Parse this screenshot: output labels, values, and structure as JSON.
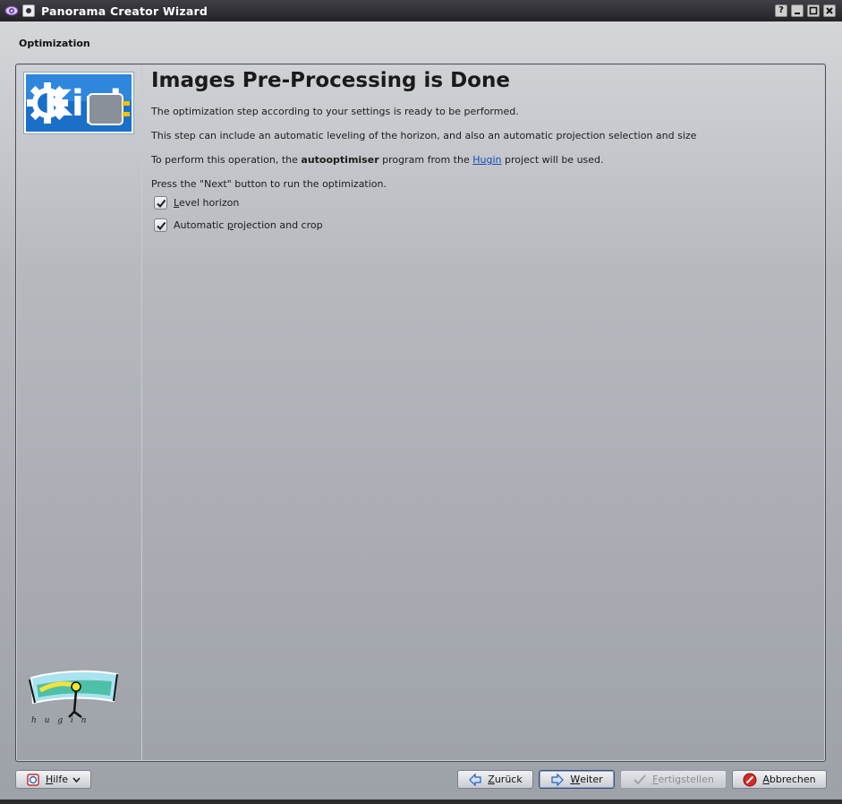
{
  "window": {
    "title": "Panorama Creator Wizard",
    "help_btn": "?",
    "minimize_btn": "–",
    "maximize_btn": "□",
    "close_btn": "✕"
  },
  "step_header": "Optimization",
  "page": {
    "title": "Images Pre-Processing is Done",
    "para1": "The optimization step according to your settings is ready to be performed.",
    "para2": "This step can include an automatic leveling of the horizon, and also an automatic projection selection and size",
    "para3_before": "To perform this operation, the ",
    "para3_program": "autooptimiser",
    "para3_middle": " program from the ",
    "para3_link": "Hugin",
    "para3_after": " project will be used.",
    "para4": "Press the \"Next\" button to run the optimization."
  },
  "options": [
    {
      "label_prefix": "",
      "mnemonic": "L",
      "label_suffix": "evel horizon",
      "checked": true
    },
    {
      "label_prefix": "Automatic ",
      "mnemonic": "p",
      "label_suffix": "rojection and crop",
      "checked": true
    }
  ],
  "logos": {
    "left_top": "kipi-logo",
    "left_bottom": "hugin-logo",
    "kipi_text": "Kipi",
    "hugin_text": "h u g i n"
  },
  "buttons": {
    "help": {
      "mnemonic": "H",
      "rest": "ilfe",
      "icon": "help-book-icon"
    },
    "back": {
      "mnemonic": "Z",
      "rest": "urück",
      "icon": "arrow-left-icon"
    },
    "next": {
      "mnemonic": "W",
      "rest": "eiter",
      "icon": "arrow-right-icon"
    },
    "finish": {
      "mnemonic": "F",
      "rest": "ertigstellen",
      "icon": "checkmark-icon",
      "enabled": false
    },
    "cancel": {
      "mnemonic": "A",
      "rest": "bbrechen",
      "icon": "stop-icon"
    }
  },
  "colors": {
    "link": "#1848b8",
    "titlebar": "#2b2b30",
    "kipi_blue": "#1a6fc9"
  }
}
